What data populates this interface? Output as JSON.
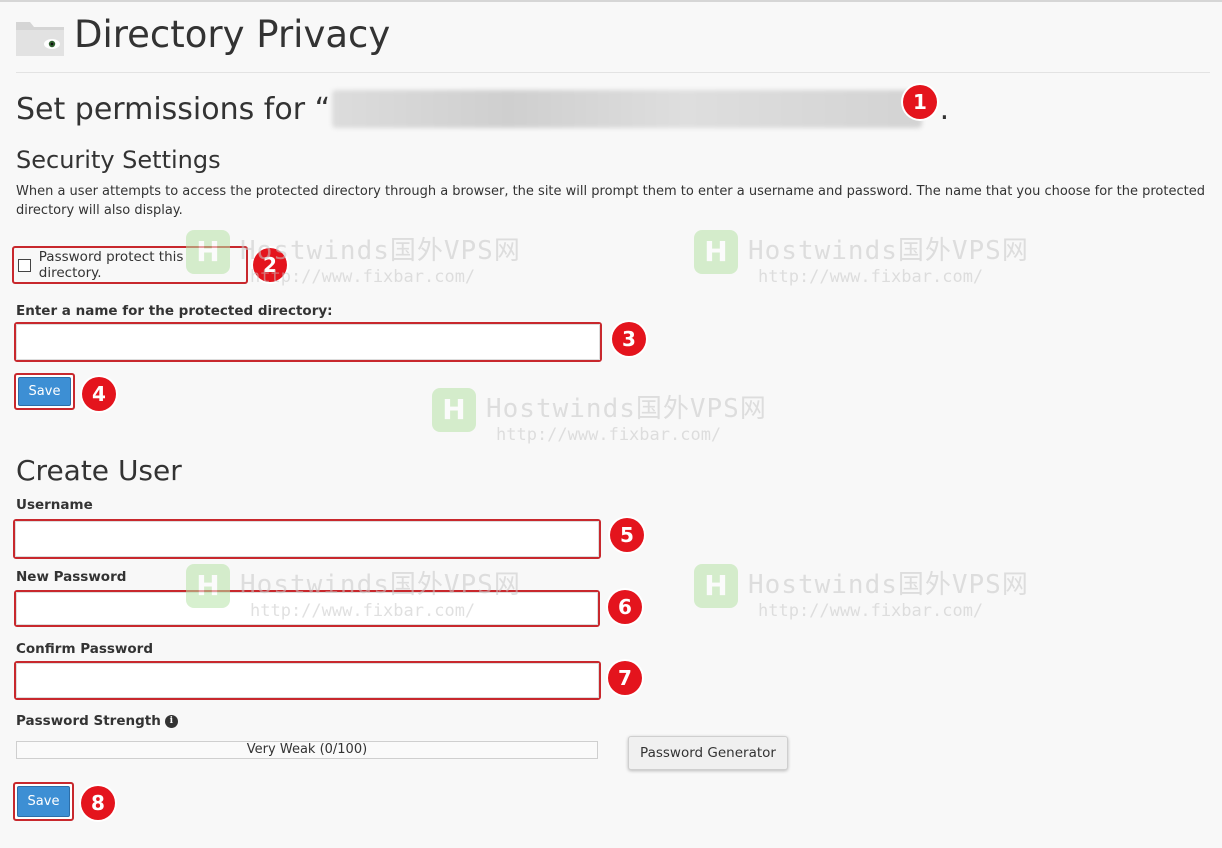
{
  "page": {
    "title": "Directory Privacy"
  },
  "permissions": {
    "prefix": "Set permissions for “",
    "suffix": "”."
  },
  "security": {
    "heading": "Security Settings",
    "description": "When a user attempts to access the protected directory through a browser, the site will prompt them to enter a username and password. The name that you choose for the protected directory will also display.",
    "checkbox_label": "Password protect this directory.",
    "name_label": "Enter a name for the protected directory:",
    "name_value": "",
    "save_label": "Save"
  },
  "create_user": {
    "heading": "Create User",
    "username_label": "Username",
    "username_value": "",
    "new_password_label": "New Password",
    "new_password_value": "",
    "confirm_password_label": "Confirm Password",
    "confirm_password_value": "",
    "strength_label": "Password Strength",
    "strength_text": "Very Weak (0/100)",
    "generator_label": "Password Generator",
    "save_label": "Save"
  },
  "badges": [
    "1",
    "2",
    "3",
    "4",
    "5",
    "6",
    "7",
    "8"
  ],
  "watermark": {
    "brand": "Hostwinds国外VPS网",
    "url": "http://www.fixbar.com/"
  },
  "colors": {
    "accent": "#3d8fd4",
    "highlight": "#c8282d",
    "badge": "#e4141d"
  }
}
